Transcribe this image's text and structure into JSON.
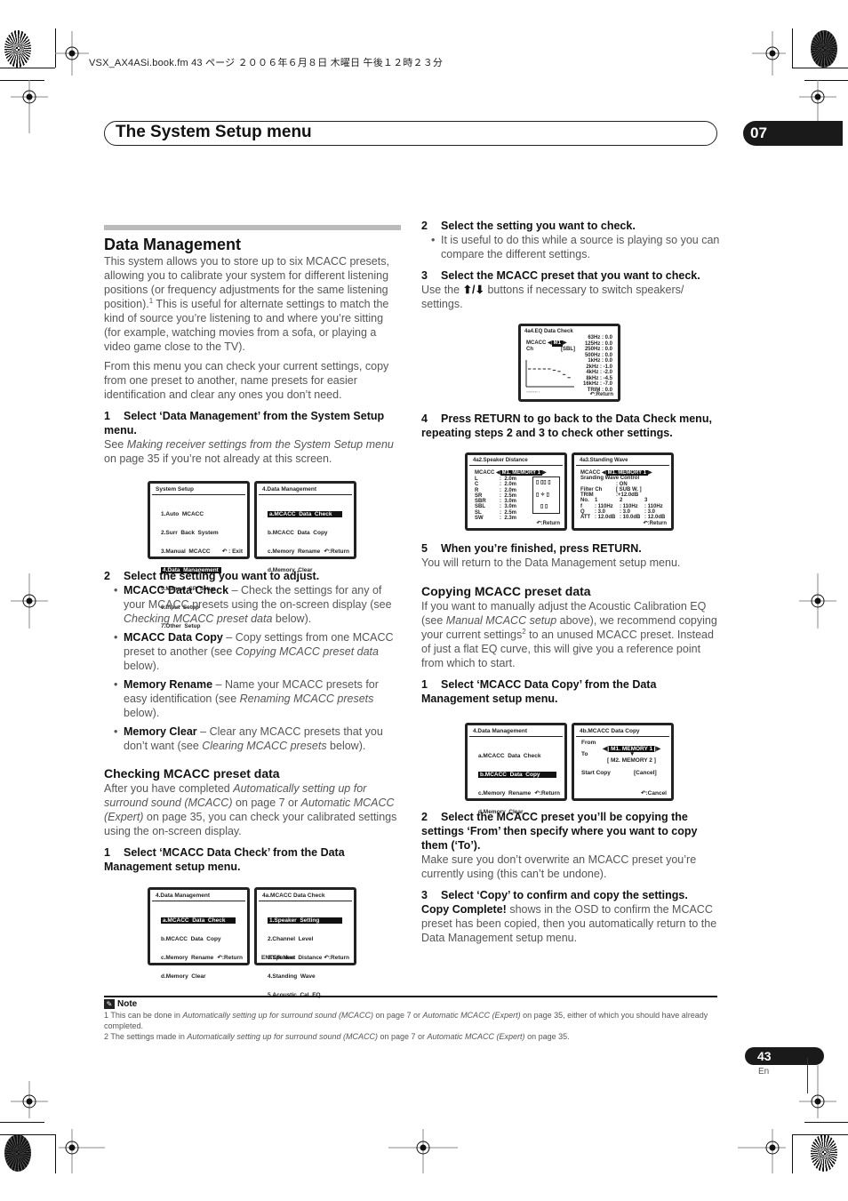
{
  "print_info": {
    "file_line": "VSX_AX4ASi.book.fm  43 ページ  ２００６年６月８日  木曜日  午後１２時２３分"
  },
  "header": {
    "title": "The System Setup menu",
    "chapter": "07"
  },
  "left_column": {
    "section_title": "Data Management",
    "intro_p1_a": "This system allows you to store up to six MCACC presets, allowing you to calibrate your system for different listening positions (or frequency adjustments for the same listening position).",
    "intro_p1_sup": "1",
    "intro_p1_b": " This is useful for alternate settings to match the kind of source you’re listening to and where you’re sitting (for example, watching movies from a sofa, or playing a video game close to the TV).",
    "intro_p2": "From this menu you can check your current settings, copy from one preset to another, name presets for easier identification and clear any ones you don’t need.",
    "step1_num": "1",
    "step1_title": "Select ‘Data Management’ from the System Setup menu.",
    "step1_see": "See ",
    "step1_ref": "Making receiver settings from the System Setup menu",
    "step1_tail": " on page 35 if you’re not already at this screen.",
    "step2_num": "2",
    "step2_title": "Select the setting you want to adjust.",
    "bullets": [
      {
        "term": "MCACC Data Check",
        "text": " – Check the settings for any of your MCACC presets using the on-screen display (see ",
        "ref": "Checking MCACC preset data",
        "tail": " below)."
      },
      {
        "term": "MCACC Data Copy",
        "text": " – Copy settings from one MCACC preset to another (see ",
        "ref": "Copying MCACC preset data",
        "tail": " below)."
      },
      {
        "term": "Memory Rename",
        "text": " – Name your MCACC presets for easy identification (see ",
        "ref": "Renaming MCACC presets",
        "tail": " below)."
      },
      {
        "term": "Memory Clear",
        "text": " – Clear any MCACC presets that you don’t want (see ",
        "ref": "Clearing MCACC presets",
        "tail": " below)."
      }
    ],
    "checking_title": "Checking MCACC preset data",
    "checking_p_a": "After you have completed ",
    "checking_ref1": "Automatically setting up for surround sound (MCACC)",
    "checking_p_b": " on page 7 or ",
    "checking_ref2": "Automatic MCACC (Expert)",
    "checking_p_c": " on page 35, you can check your calibrated settings using the on-screen display.",
    "check_step1_num": "1",
    "check_step1_title": "Select ‘MCACC Data Check’ from the Data Management setup menu."
  },
  "right_column": {
    "step2_num": "2",
    "step2_title": "Select the setting you want to check.",
    "step2_bullet": "It is useful to do this while a source is playing so you can compare the different settings.",
    "step3_num": "3",
    "step3_title": "Select the MCACC preset that you want to check.",
    "step3_text_a": "Use the ",
    "step3_arrows": "⬆/⬇",
    "step3_text_b": " buttons if necessary to switch speakers/ settings.",
    "step4_num": "4",
    "step4_title": "Press RETURN to go back to the Data Check menu, repeating steps 2 and 3 to check other settings.",
    "step5_num": "5",
    "step5_title": "When you’re finished, press RETURN.",
    "step5_text": "You will return to the Data Management setup menu.",
    "copying_title": "Copying MCACC preset data",
    "copying_p_a": "If you want to manually adjust the Acoustic Calibration EQ (see ",
    "copying_ref": "Manual MCACC setup",
    "copying_p_b": " above), we recommend copying your current settings",
    "copying_sup": "2",
    "copying_p_c": " to an unused MCACC preset. Instead of just a flat EQ curve, this will give you a reference point from which to start.",
    "copy_step1_num": "1",
    "copy_step1_title": "Select ‘MCACC Data Copy’ from the Data Management setup menu.",
    "copy_step2_num": "2",
    "copy_step2_title": "Select the MCACC preset you’ll be copying the settings ‘From’ then specify where you want to copy them (‘To’).",
    "copy_step2_text": "Make sure you don’t overwrite an MCACC preset you’re currently using (this can’t be undone).",
    "copy_step3_num": "3",
    "copy_step3_title": "Select ‘Copy’ to confirm and copy the settings.",
    "copy_step3_bold": "Copy Complete!",
    "copy_step3_text": " shows in the OSD to confirm the MCACC preset has been copied, then you automatically return to the Data Management setup menu."
  },
  "osd": {
    "system_setup": {
      "title": "System Setup",
      "items": [
        "1.Auto  MCACC",
        "2.Surr  Back  System",
        "3.Manual  MCACC",
        "4.Data  Management",
        "5.Manual  SP  Setup",
        "6.Input  Setup",
        "7.Other  Setup"
      ],
      "selected_index": 3,
      "footer": "↶ : Exit"
    },
    "data_management_a": {
      "title": "4.Data  Management",
      "items": [
        "a.MCACC  Data  Check",
        "b.MCACC  Data  Copy",
        "c.Memory  Rename",
        "d.Memory  Clear"
      ],
      "selected_index": 0,
      "footer": "↶:Return"
    },
    "data_management_b": {
      "title": "4.Data  Management",
      "items": [
        "a.MCACC  Data  Check",
        "b.MCACC  Data  Copy",
        "c.Memory  Rename",
        "d.Memory  Clear"
      ],
      "selected_index": 0,
      "footer": "↶:Return"
    },
    "data_check_menu": {
      "title": "4a.MCACC  Data  Check",
      "items": [
        "1.Speaker  Setting",
        "2.Channel  Level",
        "3.Speaker  Distance",
        "4.Standing  Wave",
        "5.Acoustic  Cal  EQ"
      ],
      "selected_index": 0,
      "footer_left": "ENTER:Next",
      "footer": "↶:Return"
    },
    "eq_data_check": {
      "title": "4a4.EQ  Data  Check",
      "mcacc_label": "MCACC",
      "mcacc_value": "M1",
      "ch_label": "Ch",
      "ch_value": "[SBL]",
      "bands": [
        {
          "f": "63Hz",
          "v": "0.0"
        },
        {
          "f": "125Hz",
          "v": "0.0"
        },
        {
          "f": "250Hz",
          "v": "0.0"
        },
        {
          "f": "500Hz",
          "v": "0.0"
        },
        {
          "f": "1kHz",
          "v": "0.0"
        },
        {
          "f": "2kHz",
          "v": "-1.0"
        },
        {
          "f": "4kHz",
          "v": "-2.0"
        },
        {
          "f": "8kHz",
          "v": "-4.5"
        },
        {
          "f": "16kHz",
          "v": "-7.0"
        },
        {
          "f": "TRIM",
          "v": "0.0"
        }
      ],
      "footer": "↶:Return"
    },
    "speaker_distance": {
      "title": "4a2.Speaker  Distance",
      "mcacc_label": "MCACC",
      "mcacc_value": "M1. MEMORY  1",
      "rows": [
        {
          "ch": "L",
          "v": "2.0m"
        },
        {
          "ch": "C",
          "v": "2.0m"
        },
        {
          "ch": "R",
          "v": "2.0m"
        },
        {
          "ch": "SR",
          "v": "2.5m"
        },
        {
          "ch": "SBR",
          "v": "3.0m"
        },
        {
          "ch": "SBL",
          "v": "3.0m"
        },
        {
          "ch": "SL",
          "v": "2.5m"
        },
        {
          "ch": "SW",
          "v": "2.3m"
        }
      ],
      "footer": "↶:Return"
    },
    "standing_wave": {
      "title": "4a3.Standing  Wave",
      "mcacc_label": "MCACC",
      "mcacc_value": "M1. MEMORY  1",
      "line1": "Sranding  Wave  Control",
      "line2": ":   ON",
      "filter_label": "Filter  Ch",
      "filter_value": "[ SUB W. ]",
      "trim_label": "TRIM",
      "trim_value": ":+12.0dB",
      "no_row": [
        "No.",
        "1",
        "2",
        "3"
      ],
      "f_row": [
        "f",
        ": 110Hz",
        ": 110Hz",
        ": 110Hz"
      ],
      "q_row": [
        "Q",
        ": 3.0",
        ": 3.0",
        ": 3.0"
      ],
      "att_row": [
        "ATT",
        ": 12.0dB",
        ": 10.0dB",
        ": 12.0dB"
      ],
      "footer": "↶:Return"
    },
    "data_copy": {
      "title": "4b.MCACC  Data  Copy",
      "from_label": "From",
      "from_value": "M1. MEMORY 1",
      "to_label": "To",
      "to_value": "[ M2. MEMORY 2 ]",
      "start_label": "Start  Copy",
      "start_value": "[Cancel]",
      "footer": "↶:Cancel"
    }
  },
  "notes": {
    "heading": "Note",
    "n1_a": "1 This can be done in ",
    "n1_ref1": "Automatically setting up for surround sound (MCACC)",
    "n1_b": " on page 7 or ",
    "n1_ref2": "Automatic MCACC (Expert)",
    "n1_c": " on page 35, either of which you should have already completed.",
    "n2_a": "2 The settings made in ",
    "n2_ref1": "Automatically setting up for surround sound (MCACC)",
    "n2_b": " on page 7 or ",
    "n2_ref2": "Automatic MCACC (Expert)",
    "n2_c": " on page 35."
  },
  "footer": {
    "page_number": "43",
    "language": "En"
  }
}
